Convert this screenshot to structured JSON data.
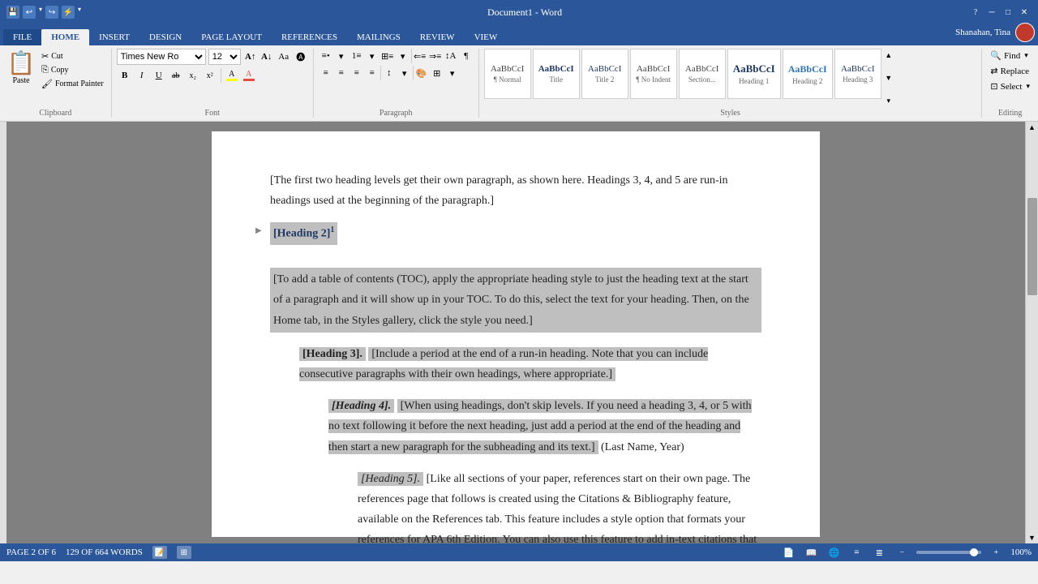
{
  "titleBar": {
    "title": "Document1 - Word",
    "icons": [
      "💾",
      "↩",
      "↪",
      "⚡"
    ],
    "controls": [
      "?",
      "─",
      "□",
      "✕"
    ]
  },
  "ribbon": {
    "tabs": [
      "FILE",
      "HOME",
      "INSERT",
      "DESIGN",
      "PAGE LAYOUT",
      "REFERENCES",
      "MAILINGS",
      "REVIEW",
      "VIEW"
    ],
    "activeTab": "HOME",
    "user": "Shanahan, Tina",
    "groups": {
      "clipboard": {
        "label": "Clipboard",
        "paste": "Paste",
        "cut": "Cut",
        "copy": "Copy",
        "formatPainter": "Format Painter"
      },
      "font": {
        "label": "Font",
        "fontName": "Times New Ro",
        "fontSize": "12",
        "bold": "B",
        "italic": "I",
        "underline": "U",
        "strikethrough": "ab",
        "sub": "x₂",
        "sup": "x²",
        "textHighlight": "A",
        "textColor": "A"
      },
      "paragraph": {
        "label": "Paragraph"
      },
      "styles": {
        "label": "Styles",
        "items": [
          {
            "preview": "AaBbCcI",
            "label": "¶ Normal"
          },
          {
            "preview": "AaBbCcI",
            "label": "Title"
          },
          {
            "preview": "AaBbCcI",
            "label": "Title 2"
          },
          {
            "preview": "AaBbCcI",
            "label": "¶ No Indent"
          },
          {
            "preview": "AaBbCcI",
            "label": "Section..."
          },
          {
            "preview": "AaBbCcI",
            "label": "Heading 1"
          },
          {
            "preview": "AaBbCcI",
            "label": "Heading 2"
          },
          {
            "preview": "AaBbCcI",
            "label": "Heading 3"
          }
        ]
      },
      "editing": {
        "label": "Editing",
        "find": "Find",
        "replace": "Replace",
        "select": "Select"
      }
    }
  },
  "document": {
    "intro": "[The first two heading levels get their own paragraph, as shown here.  Headings 3, 4, and 5 are run-in headings used at the beginning of the paragraph.]",
    "heading2": "[Heading 2]¹",
    "heading2Text": "[To add a table of contents (TOC), apply the appropriate heading style to just the heading text at the start of a paragraph and it will show up in your TOC.  To do this, select the text for your heading.  Then, on the Home tab, in the Styles gallery, click the style you need.]",
    "heading3Label": "[Heading 3].",
    "heading3Text": " [Include a period at the end of a run-in heading.  Note that you can include consecutive paragraphs with their own headings, where appropriate.]",
    "heading4Label": "[Heading 4].",
    "heading4Text": " [When using headings, don't skip levels.  If you need a heading 3, 4, or 5 with no text following it before the next heading, just add a period at the end of the heading and then start a new paragraph for the subheading and its text.]  (Last Name, Year)",
    "heading5Label": "[Heading 5].",
    "heading5Text": " [Like all sections of your paper, references start on their own page.  The references page that follows is created using the Citations & Bibliography feature, available on the References tab.  This feature includes a style option that formats your references for APA 6th Edition.  You can also use this feature to add in-text citations that are linked to your source, such"
  },
  "statusBar": {
    "page": "PAGE 2 OF 6",
    "words": "129 OF 664 WORDS",
    "zoom": "100%"
  }
}
